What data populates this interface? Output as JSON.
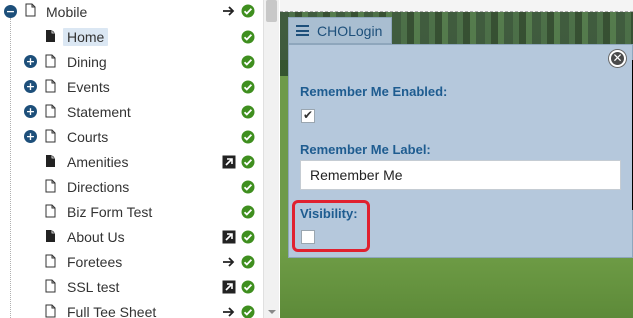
{
  "tree": {
    "root": {
      "label": "Mobile"
    },
    "items": [
      {
        "label": "Home",
        "expandable": false,
        "icon": "page-icon",
        "right_icon": null,
        "selected": true
      },
      {
        "label": "Dining",
        "expandable": true,
        "icon": "page-outline-icon",
        "right_icon": null
      },
      {
        "label": "Events",
        "expandable": true,
        "icon": "page-outline-icon",
        "right_icon": null
      },
      {
        "label": "Statement",
        "expandable": true,
        "icon": "page-outline-icon",
        "right_icon": null
      },
      {
        "label": "Courts",
        "expandable": true,
        "icon": "page-outline-icon",
        "right_icon": null
      },
      {
        "label": "Amenities",
        "expandable": false,
        "icon": "page-icon",
        "right_icon": "external-link-icon"
      },
      {
        "label": "Directions",
        "expandable": false,
        "icon": "page-outline-icon",
        "right_icon": null
      },
      {
        "label": "Biz Form Test",
        "expandable": false,
        "icon": "page-outline-icon",
        "right_icon": null
      },
      {
        "label": "About Us",
        "expandable": false,
        "icon": "page-icon",
        "right_icon": "external-link-icon"
      },
      {
        "label": "Foretees",
        "expandable": false,
        "icon": "page-outline-icon",
        "right_icon": "redirect-arrow-icon"
      },
      {
        "label": "SSL test",
        "expandable": false,
        "icon": "page-outline-icon",
        "right_icon": "external-link-icon"
      },
      {
        "label": "Full Tee Sheet",
        "expandable": false,
        "icon": "page-outline-icon",
        "right_icon": "redirect-arrow-icon"
      }
    ],
    "status_icon": "published-check-icon"
  },
  "module": {
    "title": "CHOLogin"
  },
  "settings": {
    "remember_me_enabled_label": "Remember Me Enabled:",
    "remember_me_enabled_checked": true,
    "remember_me_label_label": "Remember Me Label:",
    "remember_me_label_value": "Remember Me",
    "visibility_label": "Visibility:",
    "visibility_checked": false
  },
  "colors": {
    "accent": "#1e5c90",
    "panel": "#b5c8dc",
    "status_green": "#3f8f1f",
    "highlight": "#e0212f"
  }
}
